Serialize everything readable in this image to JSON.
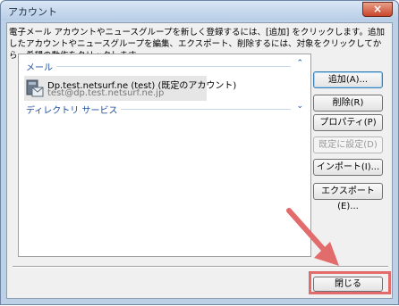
{
  "window": {
    "title": "アカウント",
    "close_glyph": "×"
  },
  "description": "電子メール アカウントやニュースグループを新しく登録するには、[追加] をクリックします。追加したアカウントやニュースグループを編集、エクスポート、削除するには、対象をクリックしてから、希望の動作をクリックします。",
  "list": {
    "mail_group": "メール",
    "directory_group": "ディレクトリ サービス",
    "account": {
      "name": "Dp.test.netsurf.ne (test) (既定のアカウント)",
      "email": "test@dp.test.netsurf.ne.jp"
    }
  },
  "buttons": {
    "add": "追加(A)...",
    "delete": "削除(R)",
    "properties": "プロパティ(P)",
    "set_default": "既定に設定(D)",
    "import": "インポート(I)...",
    "export": "エクスポート(E)...",
    "close": "閉じる"
  },
  "icons": {
    "collapse": "⌃",
    "expand": "⌄"
  },
  "colors": {
    "highlight": "#e26c6c",
    "group_header": "#1f4fa0"
  }
}
